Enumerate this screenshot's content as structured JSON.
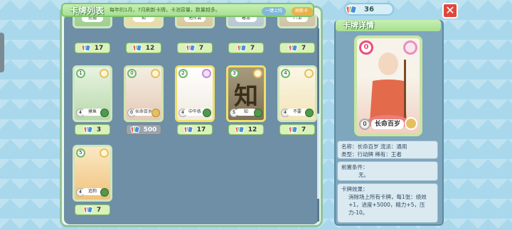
{
  "header": {
    "title": "卡牌列表",
    "note": "每年的1月，7月刷新卡牌，卡池容量，数量越多。",
    "btn_a": "一键上阵",
    "btn_b": "刷新卡牌"
  },
  "currency": {
    "value": "36"
  },
  "top_row_counts": [
    "17",
    "12",
    "7",
    "7",
    "7"
  ],
  "top_row_names": [
    "挖掘",
    "知",
    "无所谓",
    "着急",
    "八面"
  ],
  "cards_row2": [
    {
      "cost": "1",
      "name": "摸鱼",
      "lv": "4",
      "count": "3"
    },
    {
      "cost": "0",
      "name": "长命百岁",
      "lv": "0",
      "count": "500"
    },
    {
      "cost": "2",
      "name": "中午练",
      "lv": "4",
      "count": "17"
    },
    {
      "cost": "3",
      "name": "知",
      "lv": "5",
      "count": "12"
    },
    {
      "cost": "4",
      "name": "不要",
      "lv": "4",
      "count": "7"
    }
  ],
  "cards_row3": [
    {
      "cost": "5",
      "name": "追狗",
      "lv": "4",
      "count": "7"
    }
  ],
  "detail": {
    "title": "卡牌详情",
    "card_cost": "0",
    "card_name": "长命百岁",
    "card_lv": "0",
    "line1": "名称：长命百岁    流派：通用",
    "line2": "类型：行动牌    稀有：王者",
    "precond_label": "前置条件：",
    "precond_value": "无。",
    "effect_label": "卡牌效果：",
    "effect_value": "消除场上所有卡牌，每1张：绩效+1，进度+5000，精力+5，压力-10。"
  }
}
